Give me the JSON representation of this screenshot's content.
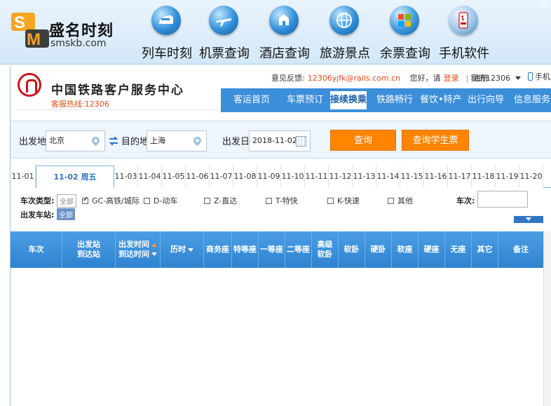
{
  "outer": {
    "brand": "盛名时刻",
    "site": "smskb.com",
    "close": "×",
    "nav": [
      {
        "label": "列车时刻",
        "icon": "train-icon"
      },
      {
        "label": "机票查询",
        "icon": "airplane-icon"
      },
      {
        "label": "酒店查询",
        "icon": "hotel-icon"
      },
      {
        "label": "旅游景点",
        "icon": "globe-icon"
      },
      {
        "label": "余票查询",
        "icon": "windows-icon"
      },
      {
        "label": "手机软件",
        "icon": "java-icon"
      }
    ]
  },
  "header": {
    "title": "中国铁路客户服务中心",
    "hotline": "客服热线:12306",
    "feedback_label": "意见反馈:",
    "feedback_email": "12306yjfk@rails.com.cn",
    "greeting": "您好，请",
    "login": "登录",
    "sep": "|",
    "register": "注册",
    "my_account": "我的12306",
    "mobile": "手机"
  },
  "mainnav": [
    {
      "label": "客运首页",
      "active": false
    },
    {
      "label": "车票预订",
      "active": false
    },
    {
      "label": "接续换乘",
      "active": true
    },
    {
      "label": "铁路畅行",
      "active": false
    },
    {
      "label": "餐饮•特产",
      "active": false
    },
    {
      "label": "出行向导",
      "active": false
    },
    {
      "label": "信息服务",
      "active": false
    }
  ],
  "search": {
    "from_label": "出发地",
    "from_value": "北京",
    "to_label": "目的地",
    "to_value": "上海",
    "date_label": "出发日",
    "date_value": "2018-11-02",
    "query_button": "查询",
    "student_button": "查询学生票"
  },
  "date_tabs": [
    "11-01",
    "11-02 周五",
    "11-03",
    "11-04",
    "11-05",
    "11-06",
    "11-07",
    "11-08",
    "11-09",
    "11-10",
    "11-11",
    "11-12",
    "11-13",
    "11-14",
    "11-15",
    "11-16",
    "11-17",
    "11-18",
    "11-19",
    "11-20"
  ],
  "active_date_index": 1,
  "filters": {
    "type_label": "车次类型:",
    "all": "全部",
    "types": [
      {
        "label": "GC-高铁/城际",
        "checked": true
      },
      {
        "label": "D-动车",
        "checked": false
      },
      {
        "label": "Z-直达",
        "checked": false
      },
      {
        "label": "T-特快",
        "checked": false
      },
      {
        "label": "K-快速",
        "checked": false
      },
      {
        "label": "其他",
        "checked": false
      }
    ],
    "train_no_label": "车次:",
    "station_label": "出发车站:",
    "station_all": "全部"
  },
  "table_headers": {
    "train": "车次",
    "dep_station": "出发站",
    "arr_station": "到达站",
    "dep_time": "出发时间",
    "arr_time": "到达时间",
    "duration": "历时",
    "business": "商务座",
    "premium": "特等座",
    "first": "一等座",
    "second": "二等座",
    "senior_soft_1": "高级",
    "senior_soft_2": "软卧",
    "soft_sleeper": "软卧",
    "hard_sleeper": "硬卧",
    "soft_seat": "软座",
    "hard_seat": "硬座",
    "no_seat": "无座",
    "other": "其它",
    "remark": "备注"
  }
}
